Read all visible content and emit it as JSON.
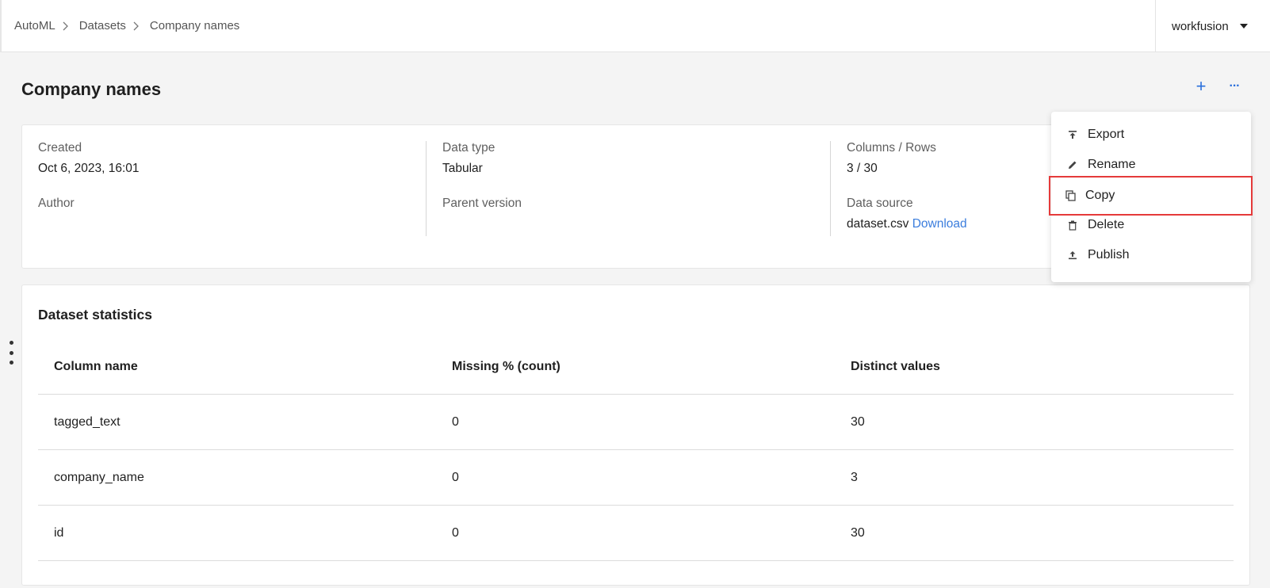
{
  "breadcrumb": {
    "items": [
      "AutoML",
      "Datasets",
      "Company names"
    ]
  },
  "user_menu": {
    "label": "workfusion"
  },
  "page": {
    "title": "Company names",
    "add_icon": "+",
    "more_icon": "···"
  },
  "info": {
    "created_label": "Created",
    "created_value": "Oct 6, 2023, 16:01",
    "author_label": "Author",
    "data_type_label": "Data type",
    "data_type_value": "Tabular",
    "parent_version_label": "Parent version",
    "columns_rows_label": "Columns / Rows",
    "columns_rows_value": "3 / 30",
    "data_source_label": "Data source",
    "data_source_file": "dataset.csv",
    "download_label": "Download"
  },
  "stats": {
    "title": "Dataset statistics",
    "headers": [
      "Column name",
      "Missing % (count)",
      "Distinct values"
    ],
    "rows": [
      [
        "tagged_text",
        "0",
        "30"
      ],
      [
        "company_name",
        "0",
        "3"
      ],
      [
        "id",
        "0",
        "30"
      ]
    ]
  },
  "dropdown": {
    "items": [
      {
        "label": "Export",
        "icon": "export-icon"
      },
      {
        "label": "Rename",
        "icon": "pencil-icon"
      },
      {
        "label": "Copy",
        "icon": "copy-icon"
      },
      {
        "label": "Delete",
        "icon": "trash-icon"
      },
      {
        "label": "Publish",
        "icon": "upload-icon"
      }
    ],
    "highlight_color": "#e53a3a"
  },
  "colors": {
    "accent": "#2a6fdb",
    "link": "#3b7ddd",
    "background": "#f4f4f4"
  }
}
